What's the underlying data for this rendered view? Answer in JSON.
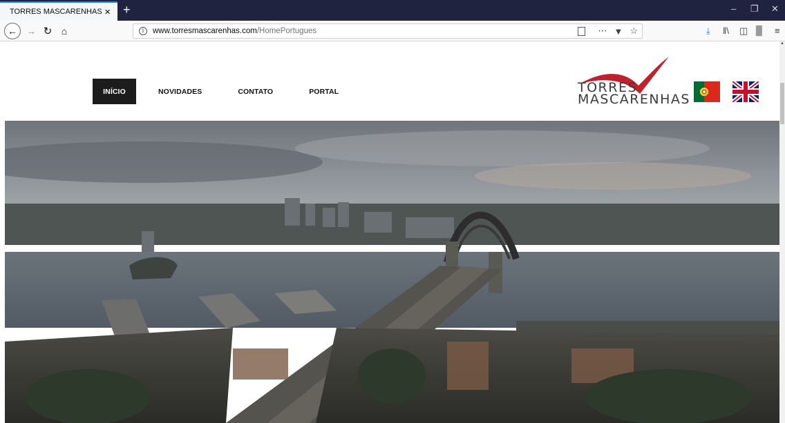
{
  "browser": {
    "tab_title": "TORRES MASCARENHAS",
    "tab_close": "×",
    "new_tab": "+",
    "url_domain": "www.torresmascarenhas.com",
    "url_path": "/HomePortugues",
    "icons": [
      "back-icon",
      "forward-icon",
      "reload-icon",
      "home-icon",
      "info-icon",
      "reader-view-icon",
      "more-icon",
      "pocket-icon",
      "bookmark-star-icon",
      "download-icon",
      "library-icon",
      "sidebar-icon",
      "reader-icon",
      "menu-icon"
    ]
  },
  "site": {
    "nav": [
      {
        "label": "INÍCIO",
        "active": true
      },
      {
        "label": "NOVIDADES",
        "active": false
      },
      {
        "label": "CONTATO",
        "active": false
      },
      {
        "label": "PORTAL",
        "active": false
      }
    ],
    "logo_line1": "TORRES",
    "logo_line2": "MASCARENHAS",
    "colors": {
      "logo_red": "#c3202e",
      "nav_active_bg": "#1c1c1c",
      "tabbar": "#202340"
    }
  }
}
